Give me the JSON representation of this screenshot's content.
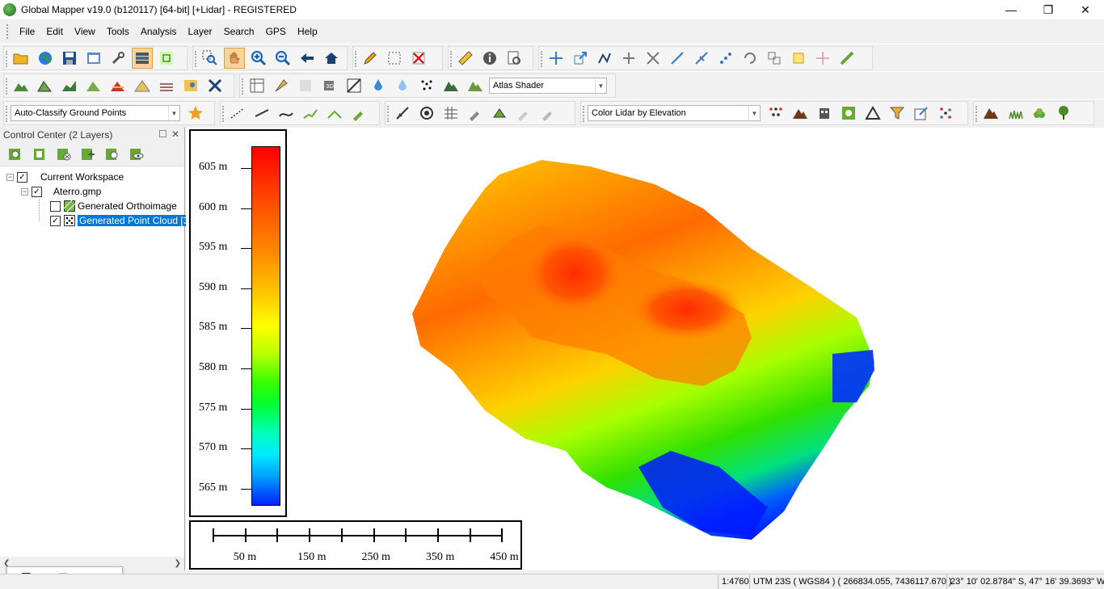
{
  "window": {
    "title": "Global Mapper v19.0 (b120117) [64-bit] [+Lidar] - REGISTERED",
    "minimize": "—",
    "maximize": "❐",
    "close": "✕"
  },
  "menu": [
    "File",
    "Edit",
    "View",
    "Tools",
    "Analysis",
    "Layer",
    "Search",
    "GPS",
    "Help"
  ],
  "toolbar": {
    "shader_select": "Atlas Shader",
    "classify_select": "Auto-Classify Ground Points",
    "lidar_color_select": "Color Lidar by Elevation"
  },
  "control_center": {
    "title": "Control Center (2 Layers)",
    "tree": {
      "workspace": "Current Workspace",
      "file": "Aterro.gmp",
      "layer1": "Generated Orthoimage",
      "layer2": "Generated Point Cloud [3"
    }
  },
  "legend": {
    "labels": [
      "605 m",
      "600 m",
      "595 m",
      "590 m",
      "585 m",
      "580 m",
      "575 m",
      "570 m",
      "565 m"
    ]
  },
  "scale_bar": {
    "labels": [
      "50 m",
      "150 m",
      "250 m",
      "350 m",
      "450 m"
    ]
  },
  "status": {
    "scale": "1:4760",
    "projection": "UTM 23S ( WGS84 ) ( 266834.055, 7436117.670 )",
    "latlon": "23° 10' 02.8784\" S, 47° 16' 39.3693\" W"
  },
  "colors": {
    "selection": "#0078d7",
    "low_elevation": "#0000ff",
    "high_elevation": "#ff0000"
  }
}
